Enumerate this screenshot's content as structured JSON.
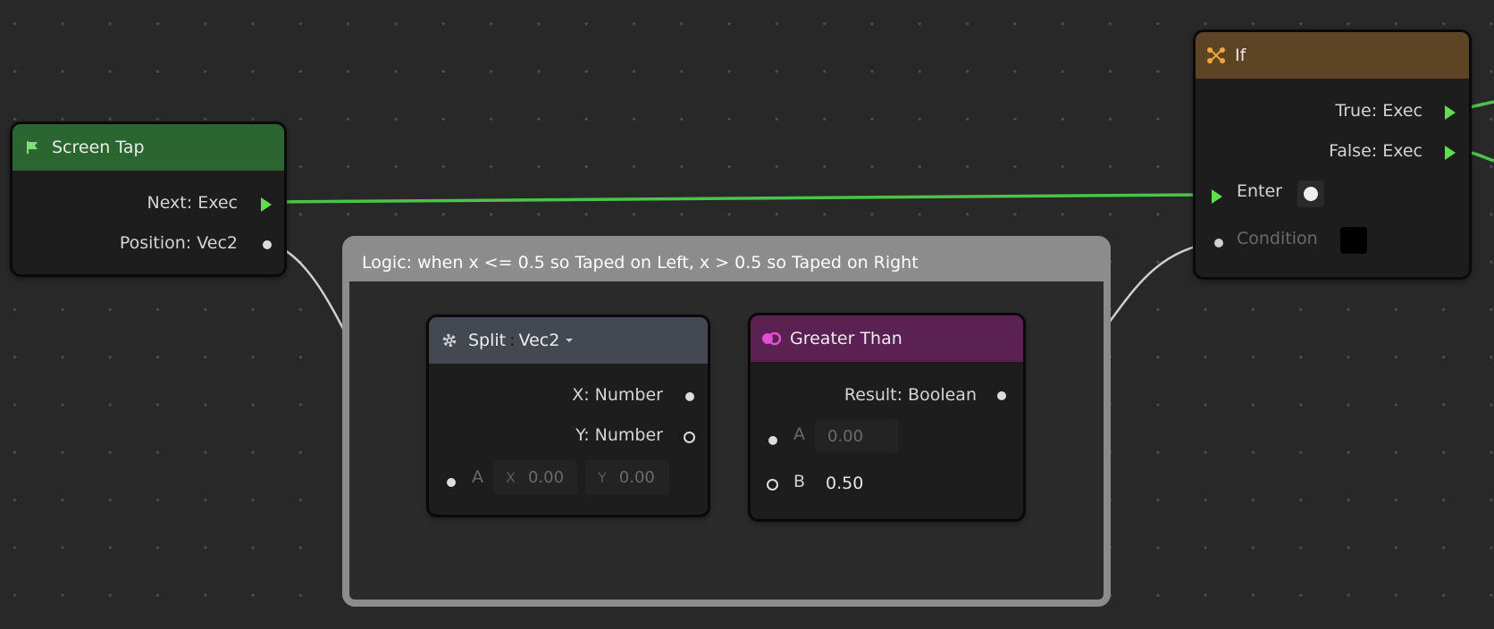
{
  "group": {
    "title": "Logic: when x <= 0.5 so Taped on Left, x > 0.5 so Taped on Right"
  },
  "nodes": {
    "screen_tap": {
      "title": "Screen Tap",
      "icon": "flag-icon",
      "header_color": "#2b6630",
      "outputs": [
        "Next: Exec",
        "Position: Vec2"
      ]
    },
    "split": {
      "title": "Split",
      "type_sep": ":",
      "type": "Vec2",
      "icon": "gear-icon",
      "header_color": "#434851",
      "outputs": [
        "X: Number",
        "Y: Number"
      ],
      "input_label": "A",
      "x_label": "X",
      "x_value": "0.00",
      "y_label": "Y",
      "y_value": "0.00"
    },
    "greater_than": {
      "title": "Greater Than",
      "icon": "compare-icon",
      "header_color": "#5a2152",
      "output": "Result: Boolean",
      "input_a_label": "A",
      "input_a_value": "0.00",
      "input_b_label": "B",
      "input_b_value": "0.50"
    },
    "if": {
      "title": "If",
      "icon": "branch-icon",
      "header_color": "#5c4424",
      "outputs": [
        "True: Exec",
        "False: Exec"
      ],
      "enter_label": "Enter",
      "condition_label": "Condition"
    }
  },
  "colors": {
    "exec_wire": "#4cc34a",
    "data_wire": "#cfcfcf",
    "background": "#282828"
  }
}
